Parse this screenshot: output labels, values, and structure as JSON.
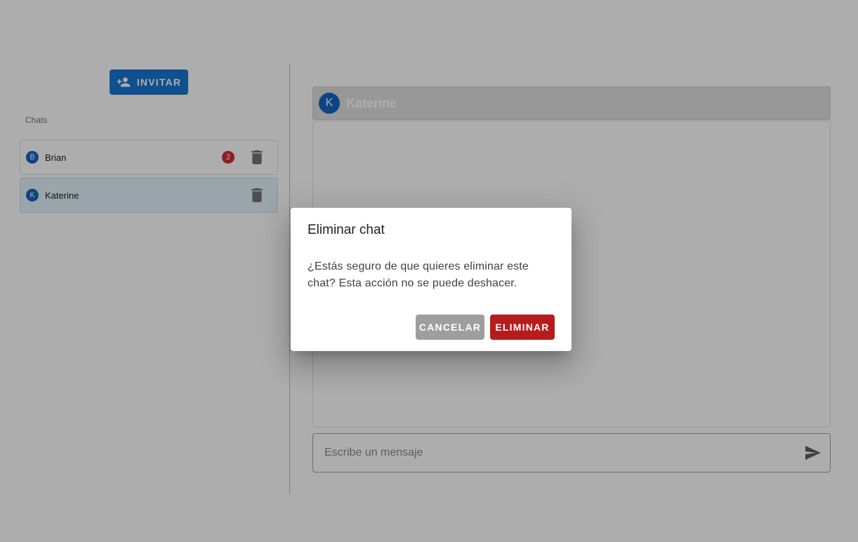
{
  "sidebar": {
    "invite_label": "INVITAR",
    "chats_label": "Chats",
    "chats": [
      {
        "initial": "B",
        "name": "Brian",
        "unread": "2",
        "selected": false
      },
      {
        "initial": "K",
        "name": "Katerine",
        "unread": "",
        "selected": true
      }
    ]
  },
  "chat": {
    "header_initial": "K",
    "header_name": "Katerine",
    "composer_placeholder": "Escribe un mensaje"
  },
  "dialog": {
    "title": "Eliminar chat",
    "message": "¿Estás seguro de que quieres eliminar este chat? Esta acción no se puede deshacer.",
    "cancel_label": "CANCELAR",
    "confirm_label": "ELIMINAR"
  },
  "colors": {
    "primary": "#1976d2",
    "avatar": "#1565c0",
    "badge": "#d32f2f",
    "danger": "#b71c1c",
    "cancel": "#9e9e9e"
  },
  "icons": {
    "invite": "person-add-icon",
    "delete": "trash-icon",
    "send": "send-icon"
  }
}
